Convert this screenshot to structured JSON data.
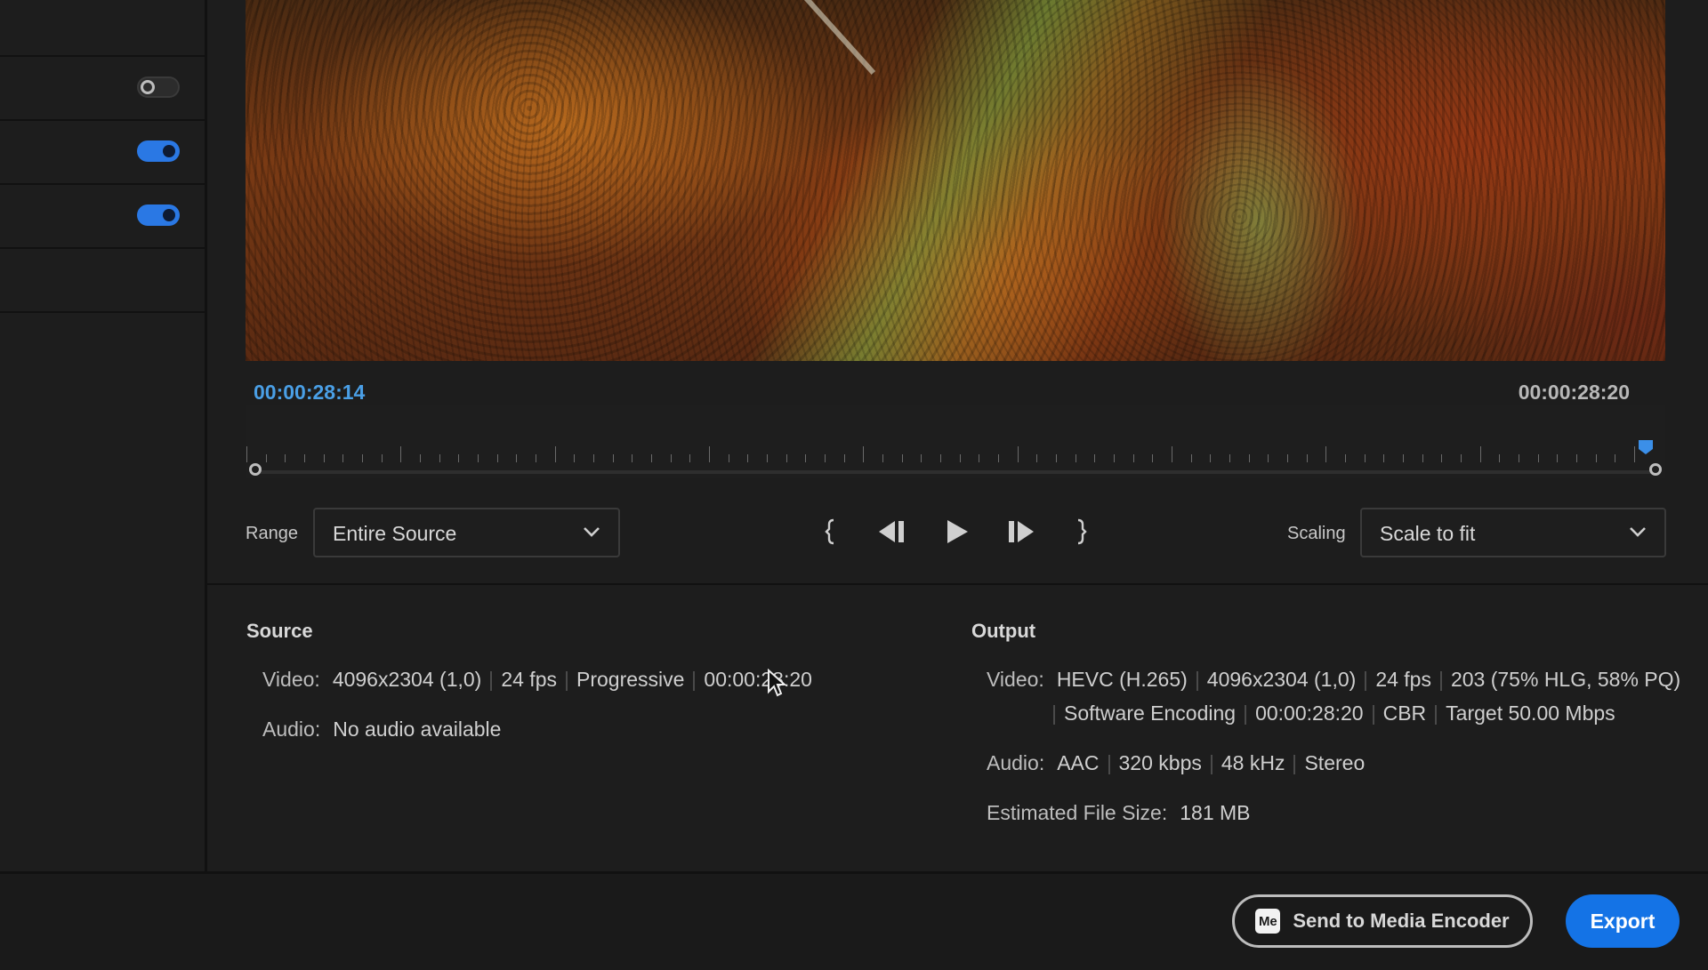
{
  "sidebar": {
    "toggles": [
      {
        "state": "off"
      },
      {
        "state": "on"
      },
      {
        "state": "on"
      }
    ]
  },
  "timeline": {
    "current_timecode": "00:00:28:14",
    "end_timecode": "00:00:28:20"
  },
  "controls": {
    "range_label": "Range",
    "range_value": "Entire Source",
    "scaling_label": "Scaling",
    "scaling_value": "Scale to fit"
  },
  "source": {
    "title": "Source",
    "video_label": "Video:",
    "video_parts": [
      "4096x2304 (1,0)",
      "24 fps",
      "Progressive",
      "00:00:28:20"
    ],
    "audio_label": "Audio:",
    "audio_value": "No audio available"
  },
  "output": {
    "title": "Output",
    "video_label": "Video:",
    "video_parts_line1": [
      "HEVC (H.265)",
      "4096x2304 (1,0)",
      "24 fps",
      "203 (75% HLG, 58% PQ)"
    ],
    "video_parts_line2": [
      "Software Encoding",
      "00:00:28:20",
      "CBR",
      "Target 50.00 Mbps"
    ],
    "audio_label": "Audio:",
    "audio_parts": [
      "AAC",
      "320 kbps",
      "48 kHz",
      "Stereo"
    ],
    "filesize_label": "Estimated File Size:",
    "filesize_value": "181 MB"
  },
  "footer": {
    "me_icon_text": "Me",
    "send_label": "Send to Media Encoder",
    "export_label": "Export"
  },
  "colors": {
    "accent": "#1473e6",
    "timecode_blue": "#4a9fe6",
    "toggle_on": "#2a78e4"
  }
}
